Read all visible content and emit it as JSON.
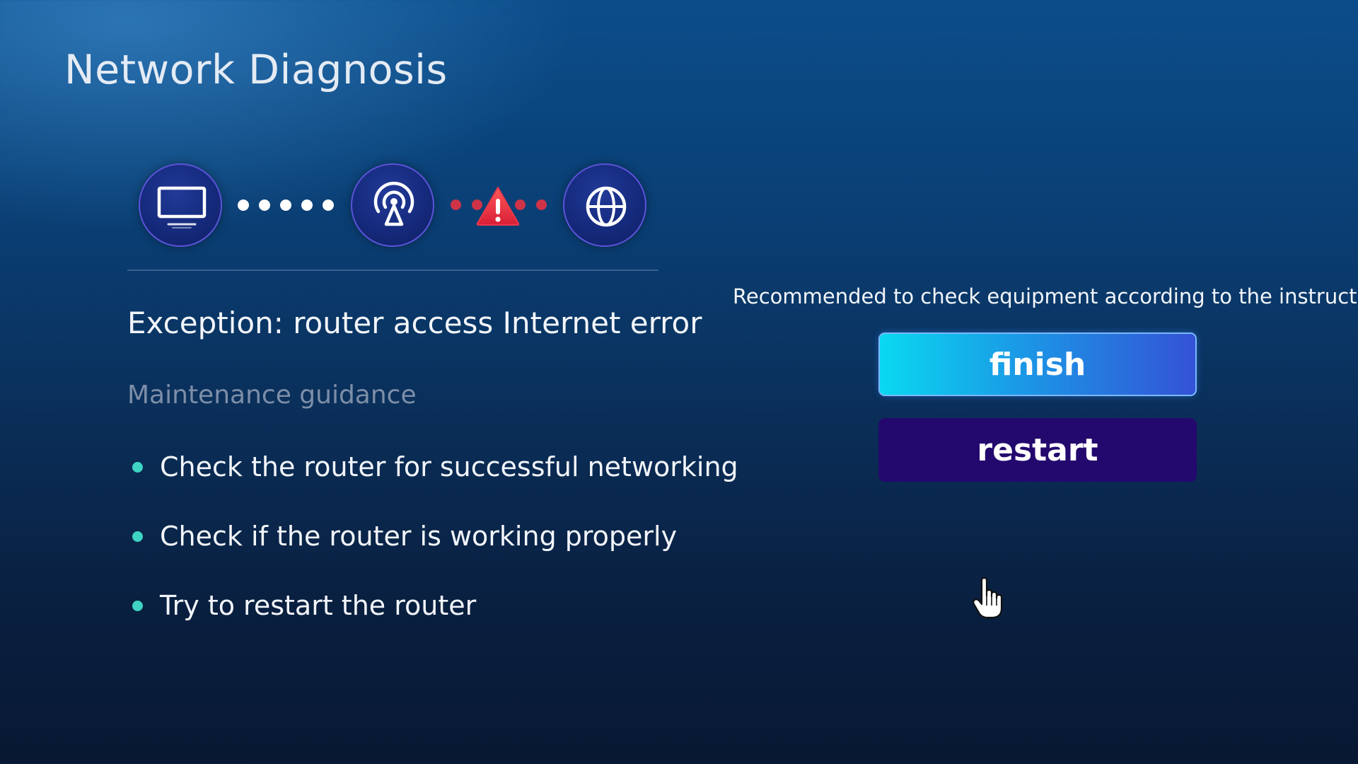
{
  "header": {
    "title": "Network Diagnosis"
  },
  "diagram": {
    "nodes": [
      {
        "name": "tv",
        "icon": "tv-icon"
      },
      {
        "name": "router",
        "icon": "router-icon"
      },
      {
        "name": "internet",
        "icon": "globe-icon"
      }
    ],
    "links": [
      {
        "status": "ok",
        "color": "#ffffff"
      },
      {
        "status": "error",
        "color": "#cf3347",
        "icon": "warning-icon"
      }
    ]
  },
  "main": {
    "exception": "Exception: router access Internet error",
    "guidance_heading": "Maintenance guidance",
    "guidance_items": [
      "Check the router for successful networking",
      "Check if the router is working properly",
      "Try to restart the router"
    ]
  },
  "side": {
    "recommendation": "Recommended to check equipment according to the instructions",
    "finish_label": "finish",
    "restart_label": "restart"
  },
  "colors": {
    "accent_cyan": "#0ad9f0",
    "accent_blue": "#3452d6",
    "restart_bg": "#23096e",
    "bullet": "#3fd3c3",
    "error": "#cf3347"
  }
}
